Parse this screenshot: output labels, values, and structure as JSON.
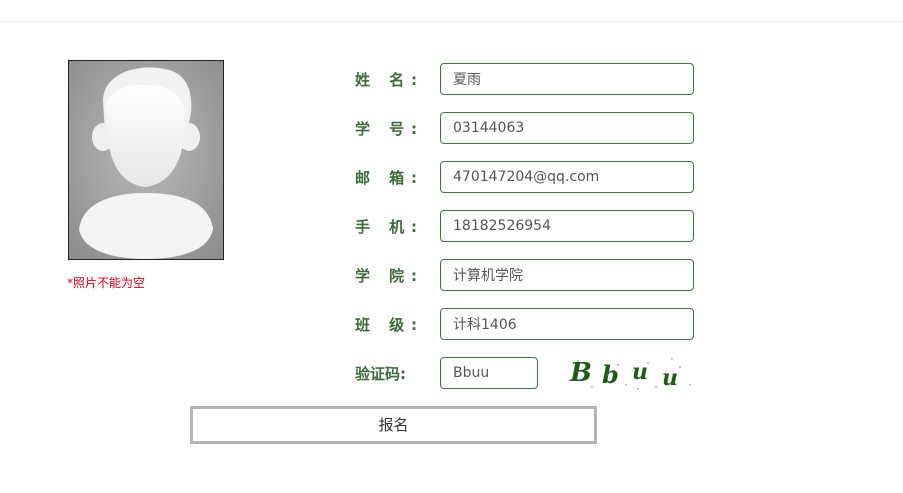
{
  "photo": {
    "warning": "*照片不能为空",
    "placeholder_icon": "avatar-silhouette-icon"
  },
  "form": {
    "fields": [
      {
        "label": "姓 名:",
        "value": "夏雨"
      },
      {
        "label": "学 号:",
        "value": "03144063"
      },
      {
        "label": "邮 箱:",
        "value": "470147204@qq.com"
      },
      {
        "label": "手 机:",
        "value": "18182526954"
      },
      {
        "label": "学 院:",
        "value": "计算机学院"
      },
      {
        "label": "班 级:",
        "value": "计科1406"
      }
    ],
    "captcha": {
      "label": "验证码:",
      "value": "Bbuu",
      "image_text": "Bbuu"
    },
    "submit_label": "报名"
  },
  "colors": {
    "label": "#3c6b3a",
    "input_border": "#3c7a3a",
    "warning": "#d0021b",
    "captcha_text": "#1f5a1a"
  }
}
